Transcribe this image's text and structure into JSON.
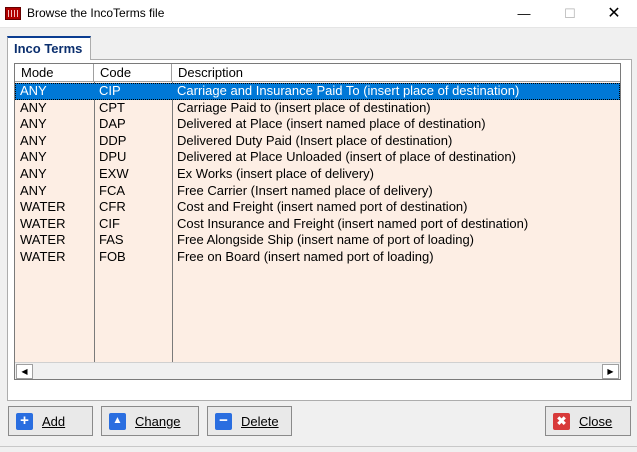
{
  "window": {
    "title": "Browse the IncoTerms file",
    "min_icon": "minimize-icon",
    "max_icon": "maximize-icon",
    "close_icon": "close-icon"
  },
  "tab": {
    "label": "Inco Terms"
  },
  "grid": {
    "columns": [
      "Mode",
      "Code",
      "Description"
    ],
    "selected_index": 0,
    "rows": [
      {
        "mode": "ANY",
        "code": "CIP",
        "description": "Carriage and Insurance Paid To (insert place of destination)"
      },
      {
        "mode": "ANY",
        "code": "CPT",
        "description": "Carriage Paid to (insert place of destination)"
      },
      {
        "mode": "ANY",
        "code": "DAP",
        "description": "Delivered at Place (insert named place of destination)"
      },
      {
        "mode": "ANY",
        "code": "DDP",
        "description": "Delivered Duty Paid (Insert place of destination)"
      },
      {
        "mode": "ANY",
        "code": "DPU",
        "description": "Delivered at Place Unloaded (insert of place of destination)"
      },
      {
        "mode": "ANY",
        "code": "EXW",
        "description": "Ex Works (insert place of delivery)"
      },
      {
        "mode": "ANY",
        "code": "FCA",
        "description": "Free Carrier (Insert named place of delivery)"
      },
      {
        "mode": "WATER",
        "code": "CFR",
        "description": "Cost and Freight (insert named port of destination)"
      },
      {
        "mode": "WATER",
        "code": "CIF",
        "description": "Cost Insurance and Freight (insert named port of destination)"
      },
      {
        "mode": "WATER",
        "code": "FAS",
        "description": "Free Alongside Ship (insert name of port of loading)"
      },
      {
        "mode": "WATER",
        "code": "FOB",
        "description": "Free on Board (insert named port of loading)"
      }
    ]
  },
  "buttons": {
    "add": {
      "label": "Add",
      "icon": "plus-icon"
    },
    "change": {
      "label": "Change",
      "icon": "triangle-up-icon"
    },
    "delete": {
      "label": "Delete",
      "icon": "minus-icon"
    },
    "close": {
      "label": "Close",
      "icon": "x-icon"
    }
  },
  "colors": {
    "selection": "#0078d7",
    "grid_bg": "#fdeee4",
    "tab_accent": "#0b3d91",
    "close_icon": "#d83a3a",
    "action_icon": "#2a6ee0"
  }
}
